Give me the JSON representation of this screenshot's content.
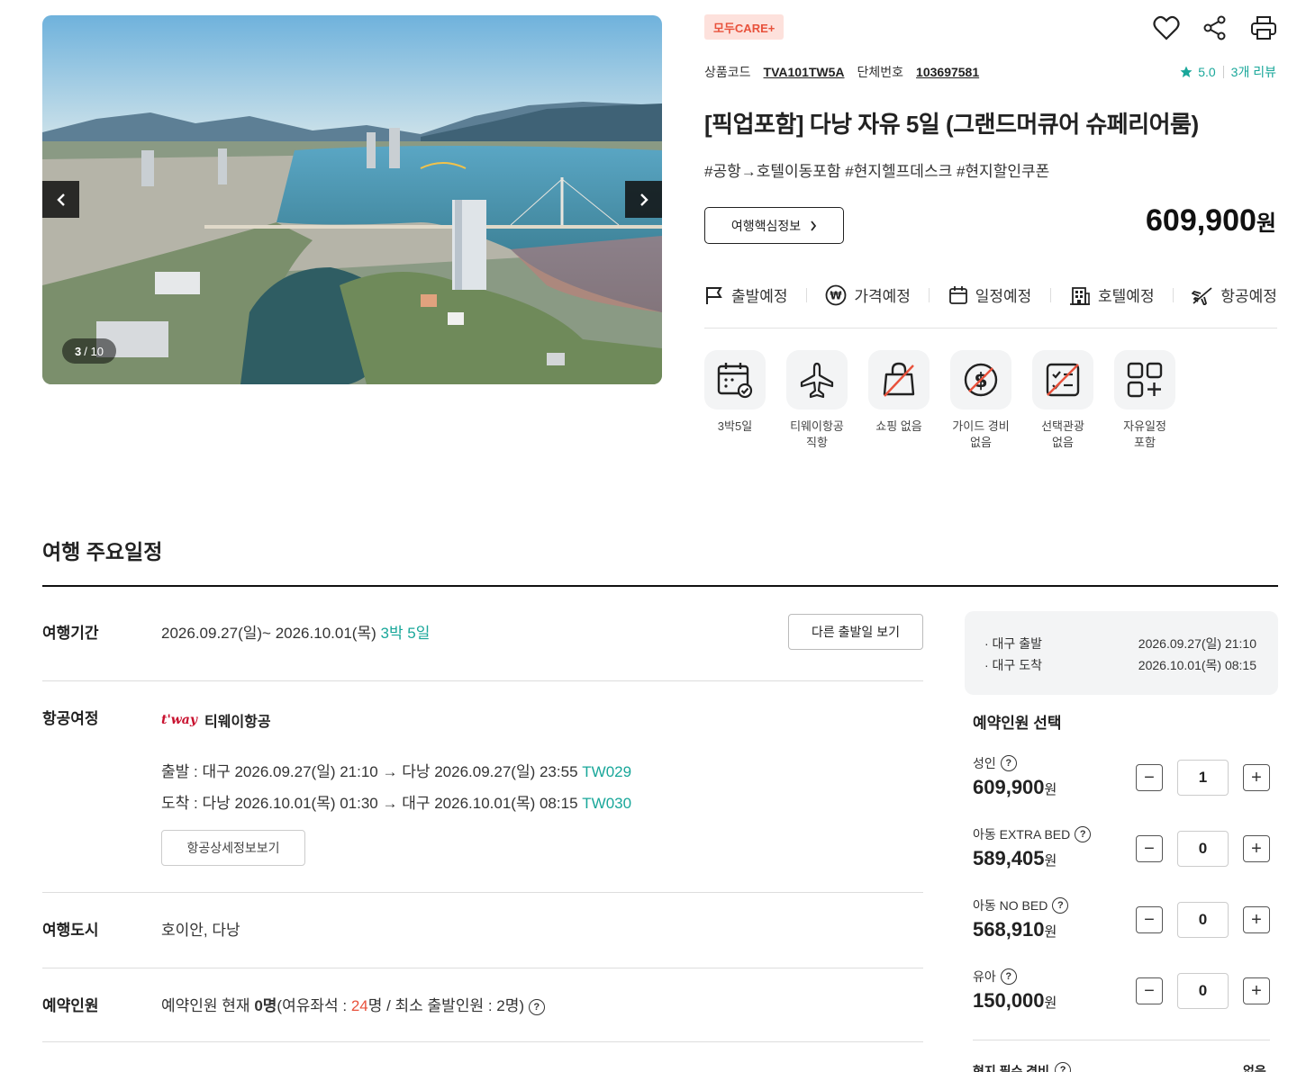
{
  "gallery": {
    "current": "3",
    "total": "/ 10"
  },
  "product": {
    "badge": "모두CARE+",
    "code_label": "상품코드",
    "code": "TVA101TW5A",
    "group_label": "단체번호",
    "group_no": "103697581",
    "rating": "5.0",
    "reviews": "3개 리뷰",
    "title": "[픽업포함] 다낭 자유 5일 (그랜드머큐어 슈페리어룸)",
    "tags": "#공항→호텔이동포함 #현지헬프데스크 #현지할인쿠폰",
    "core_button": "여행핵심정보",
    "price": "609,900",
    "price_unit": "원"
  },
  "schedule_tabs": [
    {
      "label": "출발예정",
      "icon": "flag-icon"
    },
    {
      "label": "가격예정",
      "icon": "won-icon"
    },
    {
      "label": "일정예정",
      "icon": "calendar-icon"
    },
    {
      "label": "호텔예정",
      "icon": "hotel-icon"
    },
    {
      "label": "항공예정",
      "icon": "plane-icon"
    }
  ],
  "features": [
    {
      "label": "3박5일",
      "icon": "calendar-check-icon"
    },
    {
      "label": "티웨이항공\n직항",
      "icon": "airplane-icon"
    },
    {
      "label": "쇼핑 없음",
      "icon": "no-shopping-icon"
    },
    {
      "label": "가이드 경비\n없음",
      "icon": "no-guide-fee-icon"
    },
    {
      "label": "선택관광\n없음",
      "icon": "no-optional-tour-icon"
    },
    {
      "label": "자유일정\n포함",
      "icon": "free-schedule-icon"
    }
  ],
  "itinerary": {
    "section_title": "여행 주요일정",
    "period_label": "여행기간",
    "period": "2026.09.27(일)~ 2026.10.01(목)",
    "nights": "3박 5일",
    "other_dates_button": "다른 출발일 보기",
    "flight_label": "항공여정",
    "airline_logo": "t'way",
    "airline": "티웨이항공",
    "departure": "출발 : 대구 2026.09.27(일) 21:10 → 다낭 2026.09.27(일) 23:55",
    "departure_flight": "TW029",
    "arrival": "도착 : 다낭 2026.10.01(목) 01:30 → 대구 2026.10.01(목) 08:15",
    "arrival_flight": "TW030",
    "flight_detail_button": "항공상세정보보기",
    "city_label": "여행도시",
    "cities": "호이안, 다낭",
    "booking_label": "예약인원",
    "booking_prefix": "예약인원 현재",
    "booking_current": "0명",
    "booking_seats_prefix": "(여유좌석 : ",
    "booking_seats": "24",
    "booking_seats_suffix": "명 / 최소 출발인원 : 2명)"
  },
  "booking": {
    "dep_label": "· 대구 출발",
    "dep_time": "2026.09.27(일) 21:10",
    "arr_label": "· 대구 도착",
    "arr_time": "2026.10.01(목) 08:15",
    "pax_title": "예약인원 선택",
    "pax": [
      {
        "name": "성인",
        "price": "609,900",
        "unit": "원",
        "qty": "1"
      },
      {
        "name": "아동 EXTRA BED",
        "price": "589,405",
        "unit": "원",
        "qty": "0"
      },
      {
        "name": "아동 NO BED",
        "price": "568,910",
        "unit": "원",
        "qty": "0"
      },
      {
        "name": "유아",
        "price": "150,000",
        "unit": "원",
        "qty": "0"
      }
    ],
    "minus": "−",
    "plus": "+",
    "local_fee_label": "현지 필수 경비",
    "local_fee_value": "없음"
  },
  "colors": {
    "accent": "#19a79a",
    "badge_bg": "#fde1dc",
    "badge_text": "#e8513b"
  }
}
